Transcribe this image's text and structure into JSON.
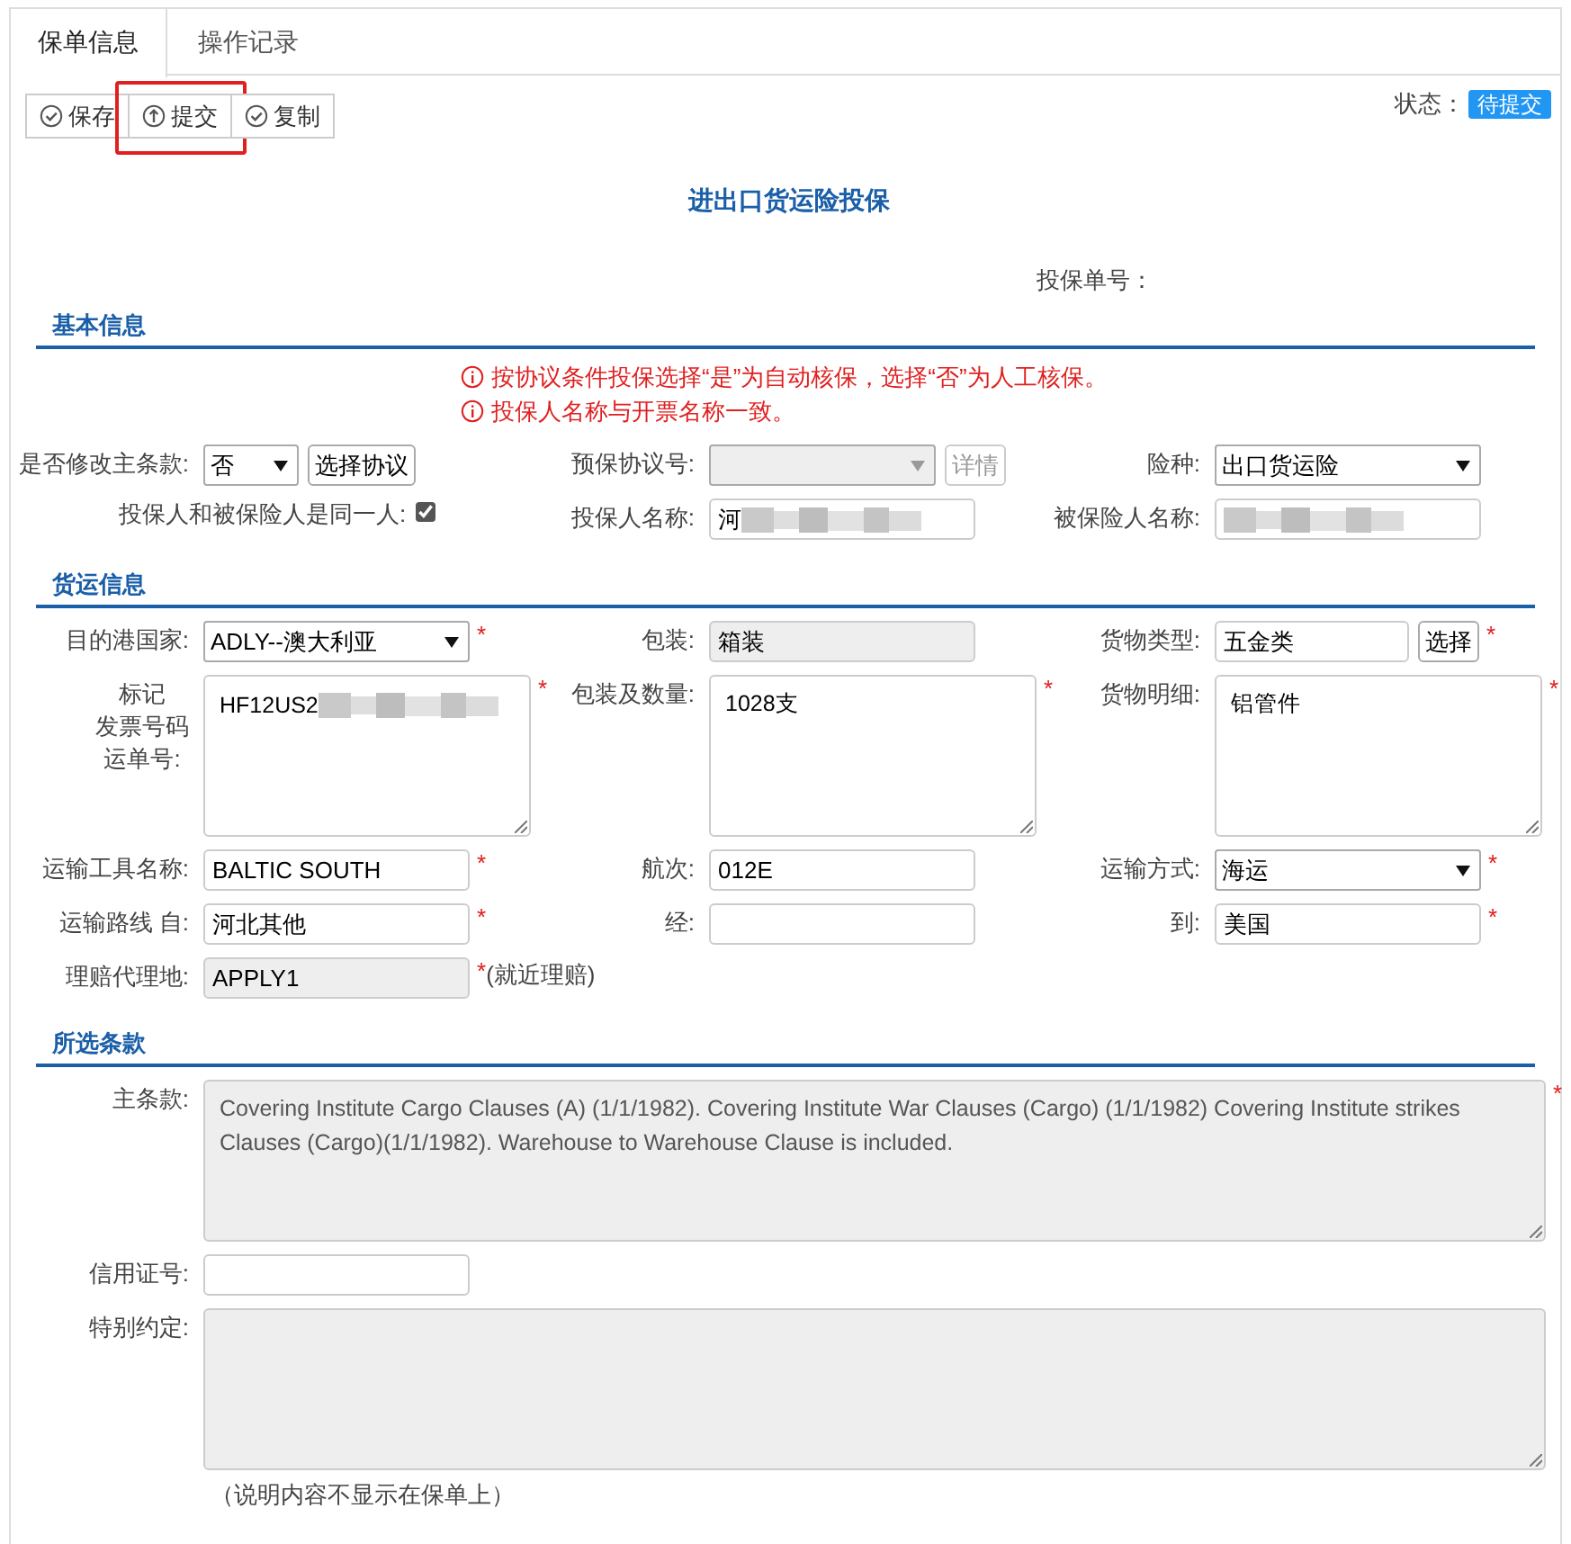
{
  "tabs": [
    {
      "label": "保单信息",
      "selected": true
    },
    {
      "label": "操作记录",
      "selected": false
    }
  ],
  "toolbar": {
    "buttons": [
      {
        "label": "保存",
        "kind": "check",
        "highlighted": false
      },
      {
        "label": "提交",
        "kind": "upload",
        "highlighted": true
      },
      {
        "label": "复制",
        "kind": "check",
        "highlighted": false
      }
    ],
    "status_label": "状态：",
    "status": "待提交"
  },
  "title": "进出口货运险投保",
  "policy_no_label": "投保单号：",
  "sections": [
    {
      "heading": "基本信息",
      "notices": [
        "按协议条件投保选择“是”为自动核保，选择“否”为人工核保。",
        "投保人名称与开票名称一致。"
      ],
      "rows": [
        [
          {
            "label": "是否修改主条款:",
            "kind": "short-select",
            "value": "否",
            "button": "选择协议",
            "disabled": false
          },
          {
            "label": "预保协议号:",
            "kind": "select",
            "disabled": true,
            "button": "详情"
          },
          {
            "label": "险种:",
            "kind": "select",
            "value": "出口货运险",
            "disabled": false
          }
        ],
        [
          {
            "label": "投保人和被保险人是同一人:",
            "kind": "checkbox",
            "checked": true
          },
          {
            "label": "投保人名称:",
            "kind": "input",
            "value": "河",
            "redacted": true
          },
          {
            "label": "被保险人名称:",
            "kind": "input",
            "redacted": true
          }
        ]
      ]
    },
    {
      "heading": "货运信息",
      "rows": [
        [
          {
            "label": "目的港国家:",
            "kind": "select",
            "value": "ADLY--澳大利亚",
            "mark": "*"
          },
          {
            "label": "包装:",
            "kind": "input",
            "value": "箱装",
            "disabled": true
          },
          {
            "label": "货物类型:",
            "kind": "input",
            "value": "五金类",
            "button": "选择",
            "mark": "*"
          }
        ],
        [
          {
            "label_lines": [
              "标记",
              "发票号码",
              "运单号:"
            ],
            "kind": "textarea",
            "value": "HF12US2",
            "redacted": true,
            "mark": "*"
          },
          {
            "label": "包装及数量:",
            "kind": "textarea",
            "value": "1028支",
            "mark": "*"
          },
          {
            "label": "货物明细:",
            "kind": "textarea",
            "value": "铝管件",
            "mark": "*"
          }
        ],
        [
          {
            "label": "运输工具名称:",
            "kind": "input",
            "value": "BALTIC SOUTH",
            "mark": "*"
          },
          {
            "label": "航次:",
            "kind": "input",
            "value": "012E"
          },
          {
            "label": "运输方式:",
            "kind": "select",
            "value": "海运",
            "mark": "*"
          }
        ],
        [
          {
            "label": "运输路线 自:",
            "kind": "input",
            "value": "河北其他",
            "mark": "*"
          },
          {
            "label": "经:",
            "kind": "input"
          },
          {
            "label": "到:",
            "kind": "input",
            "value": "美国",
            "mark": "*"
          }
        ],
        [
          {
            "label": "理赔代理地:",
            "kind": "input",
            "value": "APPLY1",
            "disabled": true,
            "mark": "*",
            "note": "(就近理赔)"
          }
        ]
      ]
    },
    {
      "heading": "所选条款",
      "rows": [
        [
          {
            "label": "主条款:",
            "kind": "textarea",
            "disabled": true,
            "mark": "*",
            "value": "Covering Institute Cargo Clauses (A) (1/1/1982). Covering Institute War Clauses (Cargo) (1/1/1982) Covering Institute strikes Clauses (Cargo)(1/1/1982). Warehouse to Warehouse Clause is included."
          }
        ],
        [
          {
            "label": "信用证号:",
            "kind": "input"
          }
        ],
        [
          {
            "label": "特别约定:",
            "kind": "textarea",
            "disabled": true,
            "hint": "（说明内容不显示在保单上）"
          }
        ]
      ]
    }
  ]
}
